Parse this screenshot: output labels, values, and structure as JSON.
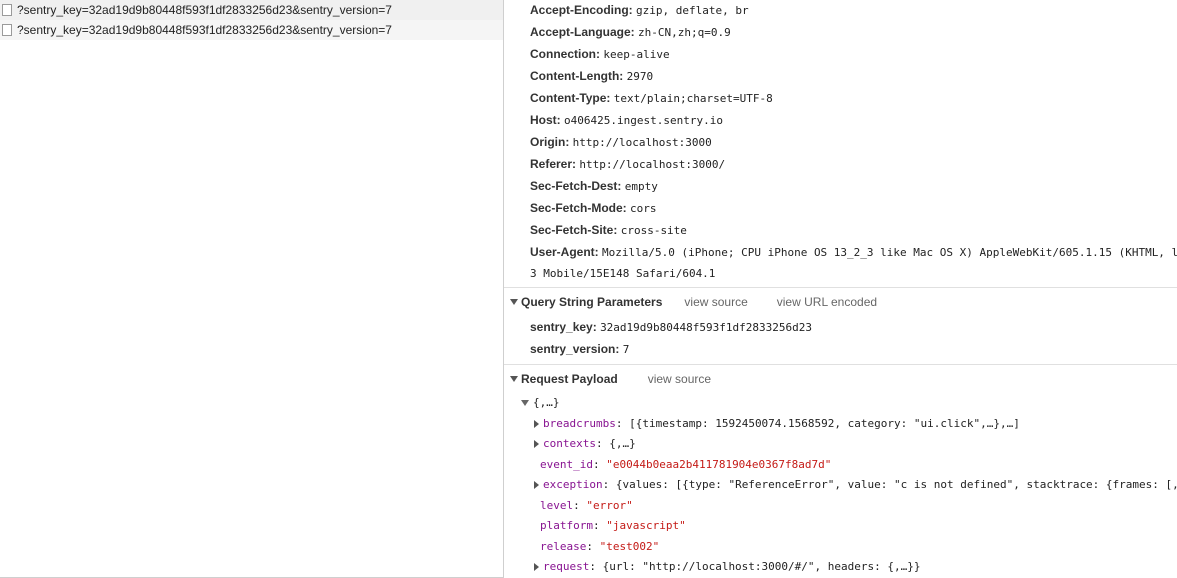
{
  "requests": [
    {
      "label": "?sentry_key=32ad19d9b80448f593f1df2833256d23&sentry_version=7"
    },
    {
      "label": "?sentry_key=32ad19d9b80448f593f1df2833256d23&sentry_version=7"
    }
  ],
  "request_headers": [
    {
      "key": "Accept-Encoding:",
      "value": "gzip, deflate, br"
    },
    {
      "key": "Accept-Language:",
      "value": "zh-CN,zh;q=0.9"
    },
    {
      "key": "Connection:",
      "value": "keep-alive"
    },
    {
      "key": "Content-Length:",
      "value": "2970"
    },
    {
      "key": "Content-Type:",
      "value": "text/plain;charset=UTF-8"
    },
    {
      "key": "Host:",
      "value": "o406425.ingest.sentry.io"
    },
    {
      "key": "Origin:",
      "value": "http://localhost:3000"
    },
    {
      "key": "Referer:",
      "value": "http://localhost:3000/"
    },
    {
      "key": "Sec-Fetch-Dest:",
      "value": "empty"
    },
    {
      "key": "Sec-Fetch-Mode:",
      "value": "cors"
    },
    {
      "key": "Sec-Fetch-Site:",
      "value": "cross-site"
    },
    {
      "key": "User-Agent:",
      "value": "Mozilla/5.0 (iPhone; CPU iPhone OS 13_2_3 like Mac OS X) AppleWebKit/605.1.15 (KHTML, l",
      "value_cont": "3 Mobile/15E148 Safari/604.1"
    }
  ],
  "query_section": {
    "title": "Query String Parameters",
    "view_source": "view source",
    "view_url_encoded": "view URL encoded",
    "params": [
      {
        "key": "sentry_key:",
        "value": "32ad19d9b80448f593f1df2833256d23"
      },
      {
        "key": "sentry_version:",
        "value": "7"
      }
    ]
  },
  "payload_section": {
    "title": "Request Payload",
    "view_source": "view source",
    "root": "{,…}",
    "fields": [
      {
        "key": "breadcrumbs",
        "value": "[{timestamp: 1592450074.1568592, category: \"ui.click\",…},…]",
        "expandable": true,
        "is_string": false
      },
      {
        "key": "contexts",
        "value": "{,…}",
        "expandable": true,
        "is_string": false
      },
      {
        "key": "event_id",
        "value": "\"e0044b0eaa2b411781904e0367f8ad7d\"",
        "expandable": false,
        "is_string": true
      },
      {
        "key": "exception",
        "value": "{values: [{type: \"ReferenceError\", value: \"c is not defined\", stacktrace: {frames: [,…",
        "expandable": true,
        "is_string": false
      },
      {
        "key": "level",
        "value": "\"error\"",
        "expandable": false,
        "is_string": true
      },
      {
        "key": "platform",
        "value": "\"javascript\"",
        "expandable": false,
        "is_string": true
      },
      {
        "key": "release",
        "value": "\"test002\"",
        "expandable": false,
        "is_string": true
      },
      {
        "key": "request",
        "value": "{url: \"http://localhost:3000/#/\", headers: {,…}}",
        "expandable": true,
        "is_string": false
      }
    ]
  }
}
